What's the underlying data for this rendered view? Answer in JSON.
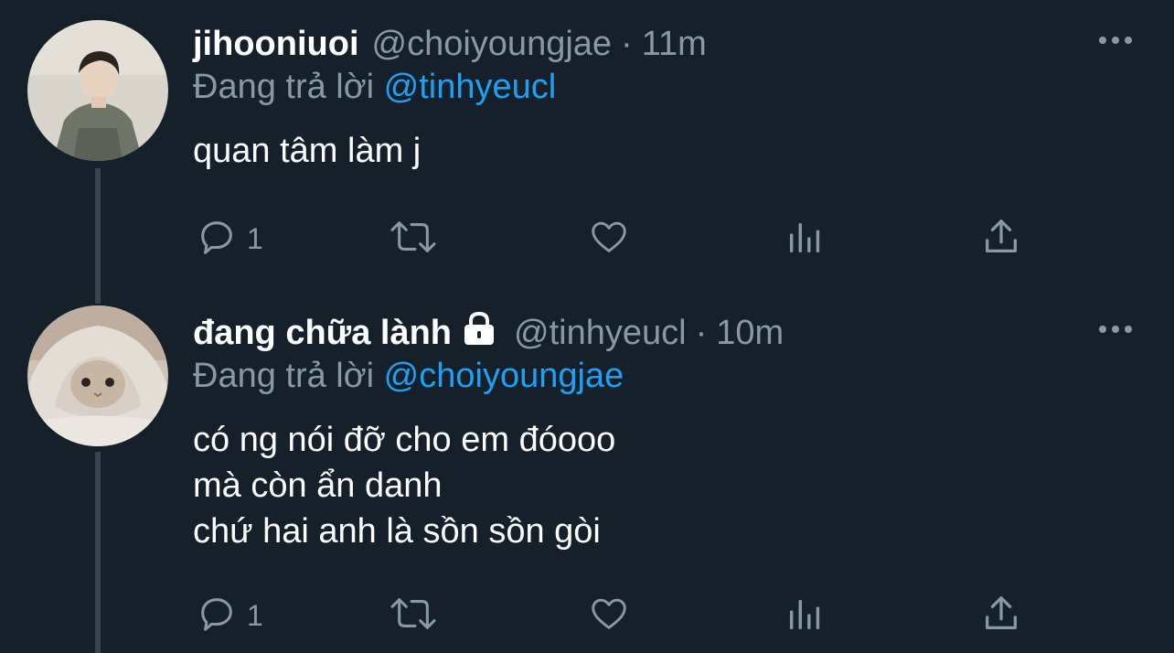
{
  "tweets": [
    {
      "display_name": "jihooniuoi",
      "handle": "@choiyoungjae",
      "separator": "·",
      "time": "11m",
      "reply_prefix": "Đang trả lời ",
      "reply_to": "@tinhyeucl",
      "locked": false,
      "body_lines": [
        "quan tâm làm j"
      ],
      "reply_count": "1"
    },
    {
      "display_name": "đang chữa lành",
      "handle": "@tinhyeucl",
      "separator": "·",
      "time": "10m",
      "reply_prefix": "Đang trả lời ",
      "reply_to": "@choiyoungjae",
      "locked": true,
      "body_lines": [
        "có ng nói đỡ cho em đóooo",
        "mà còn ẩn danh",
        "chứ hai anh là sồn sồn gòi"
      ],
      "reply_count": "1"
    }
  ],
  "icons": {
    "reply": "speech-bubble-icon",
    "retweet": "retweet-icon",
    "like": "heart-icon",
    "analytics": "bar-chart-icon",
    "share": "share-icon",
    "more": "more-dots-icon",
    "lock": "lock-icon"
  },
  "colors": {
    "background": "#15202b",
    "muted": "#8899a6",
    "link": "#1da1f2",
    "thread_line": "#38444d"
  }
}
